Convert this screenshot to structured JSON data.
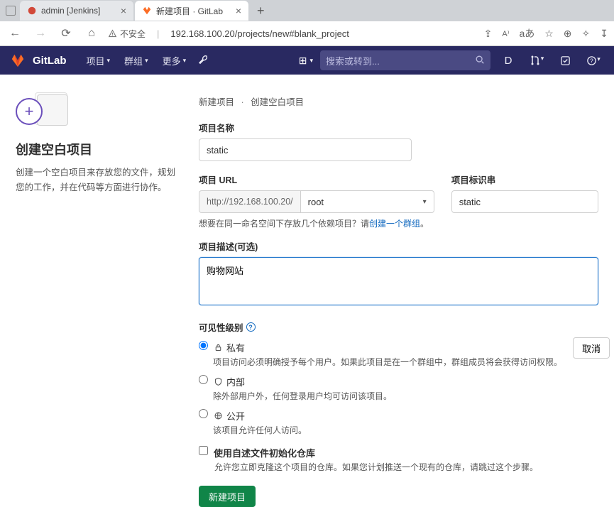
{
  "browser": {
    "tabs": [
      {
        "title": "admin [Jenkins]"
      },
      {
        "title": "新建项目 · GitLab"
      }
    ],
    "insecure_label": "不安全",
    "url": "192.168.100.20/projects/new#blank_project"
  },
  "nav": {
    "brand": "GitLab",
    "menu": {
      "projects": "项目",
      "groups": "群组",
      "more": "更多"
    },
    "search_placeholder": "搜索或转到..."
  },
  "left": {
    "title": "创建空白项目",
    "desc": "创建一个空白项目来存放您的文件，规划您的工作，并在代码等方面进行协作。"
  },
  "breadcrumb": {
    "a": "新建项目",
    "b": "创建空白项目"
  },
  "form": {
    "name_label": "项目名称",
    "name_value": "static",
    "url_label": "项目 URL",
    "url_prefix": "http://192.168.100.20/",
    "url_namespace": "root",
    "slug_label": "项目标识串",
    "slug_value": "static",
    "namespace_hint": "想要在同一命名空间下存放几个依赖项目？请",
    "namespace_hint_link": "创建一个群组",
    "desc_label": "项目描述(可选)",
    "desc_value": "购物网站",
    "visibility_label": "可见性级别",
    "vis": {
      "private_title": "私有",
      "private_desc": "项目访问必须明确授予每个用户。如果此项目是在一个群组中，群组成员将会获得访问权限。",
      "internal_title": "内部",
      "internal_desc": "除外部用户外，任何登录用户均可访问该项目。",
      "public_title": "公开",
      "public_desc": "该项目允许任何人访问。"
    },
    "init_label": "使用自述文件初始化仓库",
    "init_desc": "允许您立即克隆这个项目的仓库。如果您计划推送一个现有的仓库，请跳过这个步骤。",
    "submit": "新建项目",
    "cancel": "取消"
  }
}
